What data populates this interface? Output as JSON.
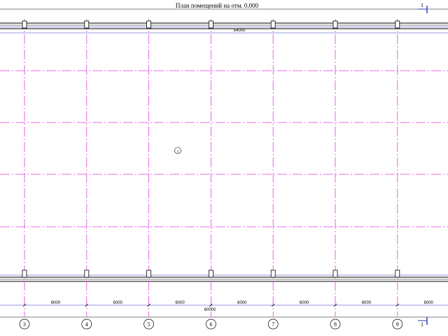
{
  "drawing": {
    "title": "План помещений на отм. 0.000",
    "overall_dimension_top": "54000",
    "overall_dimension_bottom": "60000",
    "room_number": "1",
    "section_mark_top": "1",
    "section_mark_bottom": "1",
    "axes": [
      {
        "label": "3",
        "span_after": "6000"
      },
      {
        "label": "4",
        "span_after": "6000"
      },
      {
        "label": "5",
        "span_after": "6000"
      },
      {
        "label": "6",
        "span_after": "6000"
      },
      {
        "label": "7",
        "span_after": "6000"
      },
      {
        "label": "8",
        "span_after": "6000"
      },
      {
        "label": "9",
        "span_after": "6000"
      }
    ],
    "colors": {
      "grid": "#e040e0",
      "wall": "#000000",
      "dimension": "#3030c0",
      "background": "#ffffff"
    }
  }
}
